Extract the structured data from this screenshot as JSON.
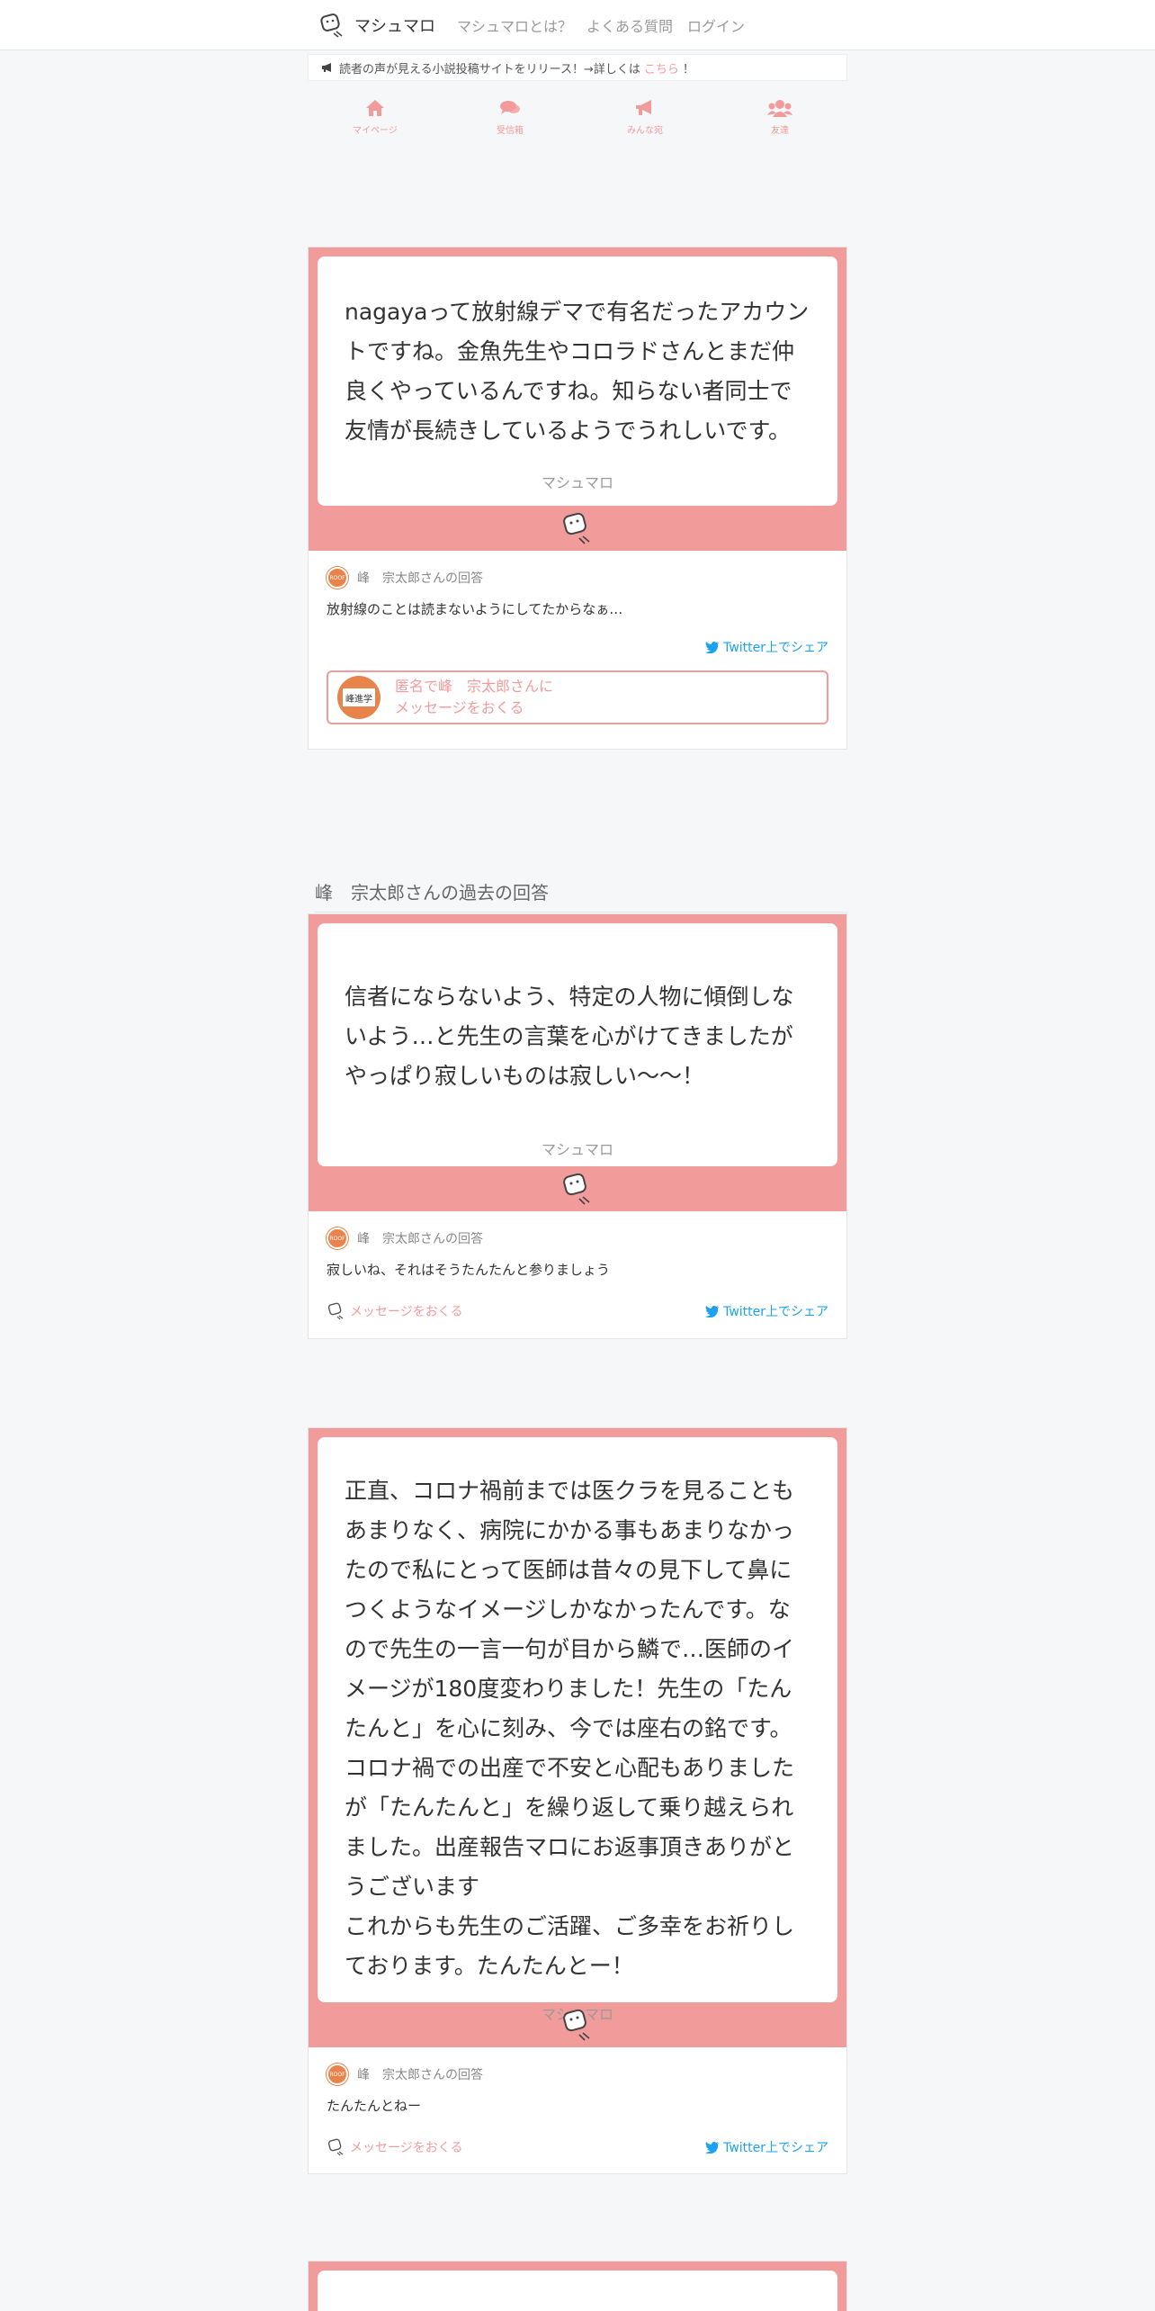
{
  "nav": {
    "brand": "マシュマロ",
    "links": [
      "マシュマロとは？",
      "よくある質問",
      "ログイン"
    ]
  },
  "notice": {
    "text": "読者の声が見える小説投稿サイトをリリース！→詳しくは",
    "link": "こちら",
    "suffix": "！"
  },
  "icon_nav": [
    {
      "label": "マイページ",
      "icon": "home-icon"
    },
    {
      "label": "受信箱",
      "icon": "comments-icon"
    },
    {
      "label": "みんな宛",
      "icon": "bullhorn-icon"
    },
    {
      "label": "友達",
      "icon": "users-icon"
    }
  ],
  "main_card": {
    "question": "nagayaって放射線デマで有名だったアカウントですね。金魚先生やコロラドさんとまだ仲良くやっているんですね。知らない者同士で友情が長続きしているようでうれしいです。",
    "signature": "マシュマロ",
    "answer_header": "峰　宗太郎さんの回答",
    "answer": "放射線のことは読まないようにしてたからなぁ…￼",
    "share": "Twitter上でシェア",
    "cta_line1": "匿名で峰　宗太郎さんに",
    "cta_line2": "メッセージをおくる",
    "avatar_text": "峰進学"
  },
  "past_title": "峰　宗太郎さんの過去の回答",
  "past": [
    {
      "question": "信者にならないよう、特定の人物に傾倒しないよう…と￼先生の言葉を心がけてきましたがやっぱり寂しいものは寂しい〜〜！￼",
      "signature": "マシュマロ",
      "answer_header": "峰　宗太郎さんの回答",
      "answer": "寂しいね、それはそう￼たんたんと参りましょう",
      "send": "メッセージをおくる",
      "share": "Twitter上でシェア"
    },
    {
      "question": "正直、コロナ禍前までは医クラを見ることもあまりなく、病院にかかる事もあまりなかったので私にとって医師は昔々の見下して鼻につくようなイメージしかなかったんです。なので￼先生の一言一句が目から鱗で…医師のイメージが180度変わりました！￼先生の「たんたんと」を心に刻み、今では座右の銘です。コロナ禍での出産で不安と心配もありましたが「たんたんと」を繰り返して乗り越えられました。出産報告マロにお返事頂きありがとうございます￼\nこれからも￼先生のご活躍、ご多幸をお祈りしております。たんたんとー！",
      "signature": "マシュマロ",
      "answer_header": "峰　宗太郎さんの回答",
      "answer": "たんたんとねー￼",
      "send": "メッセージをおくる",
      "share": "Twitter上でシェア"
    }
  ],
  "colors": {
    "accent": "#f29b9b",
    "twitter": "#1da1f2",
    "avatar": "#e8834b"
  }
}
